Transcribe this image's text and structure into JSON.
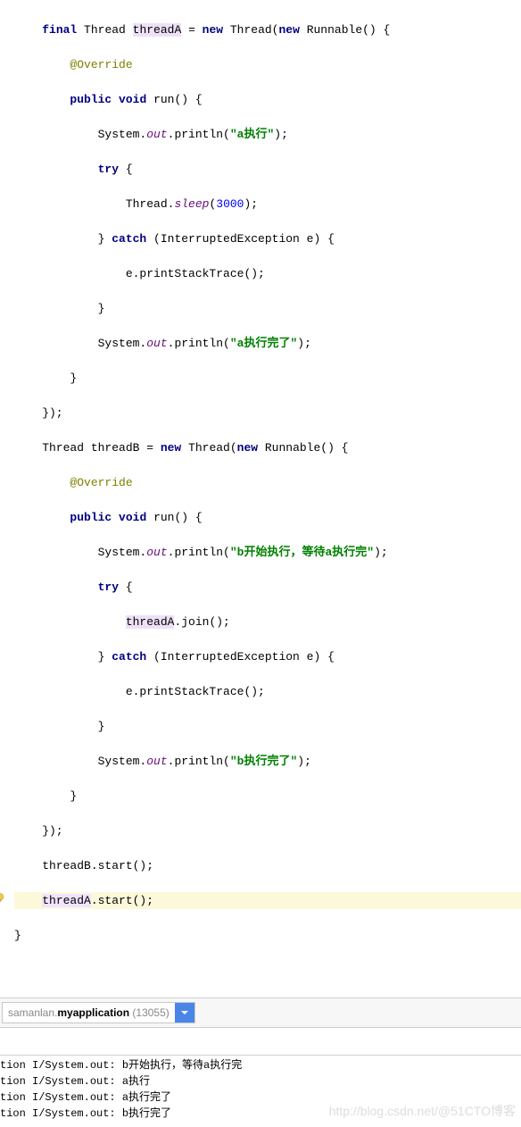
{
  "code": {
    "l1": {
      "pre": "    ",
      "kw1": "final",
      "sp1": " Thread ",
      "var": "threadA",
      "sp2": " = ",
      "kw2": "new",
      "sp3": " Thread(",
      "kw3": "new",
      "sp4": " Runnable() {"
    },
    "l2": {
      "pre": "        ",
      "ann": "@Override"
    },
    "l3": {
      "pre": "        ",
      "kw1": "public",
      "sp1": " ",
      "kw2": "void",
      "rest": " run() {"
    },
    "l4": {
      "pre": "            System.",
      "fld": "out",
      "mid": ".println(",
      "str": "\"a执行\"",
      "end": ");"
    },
    "l5": {
      "pre": "            ",
      "kw": "try",
      "rest": " {"
    },
    "l6": {
      "pre": "                Thread.",
      "fld": "sleep",
      "mid": "(",
      "num": "3000",
      "end": ");"
    },
    "l7": {
      "pre": "            } ",
      "kw": "catch",
      "rest": " (InterruptedException e) {"
    },
    "l8": {
      "text": "                e.printStackTrace();"
    },
    "l9": {
      "text": "            }"
    },
    "l10": {
      "pre": "            System.",
      "fld": "out",
      "mid": ".println(",
      "str": "\"a执行完了\"",
      "end": ");"
    },
    "l11": {
      "text": "        }"
    },
    "l12": {
      "text": "    });"
    },
    "l13": {
      "pre": "    Thread threadB = ",
      "kw1": "new",
      "sp1": " Thread(",
      "kw2": "new",
      "rest": " Runnable() {"
    },
    "l14": {
      "pre": "        ",
      "ann": "@Override"
    },
    "l15": {
      "pre": "        ",
      "kw1": "public",
      "sp1": " ",
      "kw2": "void",
      "rest": " run() {"
    },
    "l16": {
      "pre": "            System.",
      "fld": "out",
      "mid": ".println(",
      "str": "\"b开始执行，等待a执行完\"",
      "end": ");"
    },
    "l17": {
      "pre": "            ",
      "kw": "try",
      "rest": " {"
    },
    "l18": {
      "pre": "                ",
      "var": "threadA",
      "rest": ".join();"
    },
    "l19": {
      "pre": "            } ",
      "kw": "catch",
      "rest": " (InterruptedException e) {"
    },
    "l20": {
      "text": "                e.printStackTrace();"
    },
    "l21": {
      "text": "            }"
    },
    "l22": {
      "pre": "            System.",
      "fld": "out",
      "mid": ".println(",
      "str": "\"b执行完了\"",
      "end": ");"
    },
    "l23": {
      "text": "        }"
    },
    "l24": {
      "text": "    });"
    },
    "l25": {
      "text": "    threadB.start();"
    },
    "l26": {
      "pre": "    ",
      "var": "threadA",
      "rest": ".start();"
    },
    "l27": {
      "text": "}"
    }
  },
  "process": {
    "prefix": "samanlan.",
    "bold": "myapplication",
    "pid": " (13055)"
  },
  "log": {
    "prefix": "tion I/System.out: ",
    "m1": "b开始执行，等待a执行完",
    "m2": "a执行",
    "m3": "a执行完了",
    "m4": "b执行完了"
  },
  "watermark": "http://blog.csdn.net/@51CTO博客"
}
